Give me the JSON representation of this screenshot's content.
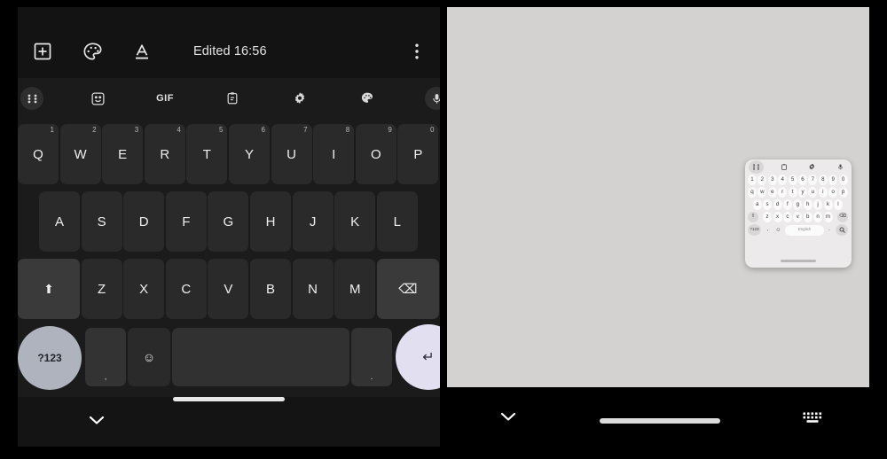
{
  "left_panel": {
    "toolbar": {
      "add_icon": "add-box-icon",
      "palette_icon": "palette-icon",
      "format_icon": "format-text-underline-icon",
      "status_text": "Edited 16:56",
      "overflow_icon": "more-vertical-icon"
    },
    "keyboard_strip": {
      "items": [
        {
          "name": "grid-menu-icon",
          "label": ""
        },
        {
          "name": "sticker-icon",
          "label": ""
        },
        {
          "name": "gif-icon",
          "label": "GIF"
        },
        {
          "name": "clipboard-icon",
          "label": ""
        },
        {
          "name": "settings-gear-icon",
          "label": ""
        },
        {
          "name": "theme-palette-icon",
          "label": ""
        },
        {
          "name": "microphone-icon",
          "label": ""
        }
      ]
    },
    "keyboard": {
      "row1": [
        {
          "key": "Q",
          "sup": "1"
        },
        {
          "key": "W",
          "sup": "2"
        },
        {
          "key": "E",
          "sup": "3"
        },
        {
          "key": "R",
          "sup": "4"
        },
        {
          "key": "T",
          "sup": "5"
        },
        {
          "key": "Y",
          "sup": "6"
        },
        {
          "key": "U",
          "sup": "7"
        },
        {
          "key": "I",
          "sup": "8"
        },
        {
          "key": "O",
          "sup": "9"
        },
        {
          "key": "P",
          "sup": "0"
        }
      ],
      "row2": [
        "A",
        "S",
        "D",
        "F",
        "G",
        "H",
        "J",
        "K",
        "L"
      ],
      "row3": {
        "shift_label": "⬆",
        "letters": [
          "Z",
          "X",
          "C",
          "V",
          "B",
          "N",
          "M"
        ],
        "backspace_label": "⌫"
      },
      "row4": {
        "symbols_label": "?123",
        "comma_label": ",",
        "emoji_label": "☺",
        "space_label": "",
        "period_label": ".",
        "enter_label": "↵"
      }
    },
    "nav_bar": {
      "back_icon": "chevron-down-icon",
      "home_indicator": "home-pill"
    }
  },
  "right_panel": {
    "canvas_label": "",
    "mini_keyboard": {
      "strip": [
        {
          "name": "grid-menu-icon"
        },
        {
          "name": "clipboard-icon"
        },
        {
          "name": "settings-gear-icon"
        },
        {
          "name": "microphone-icon"
        }
      ],
      "row_numbers": [
        "1",
        "2",
        "3",
        "4",
        "5",
        "6",
        "7",
        "8",
        "9",
        "0"
      ],
      "row1": [
        "q",
        "w",
        "e",
        "r",
        "t",
        "y",
        "u",
        "i",
        "o",
        "p"
      ],
      "row2": [
        "a",
        "s",
        "d",
        "f",
        "g",
        "h",
        "j",
        "k",
        "l"
      ],
      "row3": {
        "shift_label": "⇧",
        "letters": [
          "z",
          "x",
          "c",
          "v",
          "b",
          "n",
          "m"
        ],
        "backspace_label": "⌫"
      },
      "row4": {
        "symbols_label": "?123",
        "comma_label": ",",
        "emoji_label": "☺",
        "space_label": "English",
        "period_label": ".",
        "search_label": "search-icon"
      }
    },
    "nav_bar": {
      "back_icon": "chevron-down-icon",
      "home_indicator": "home-pill",
      "keyboard_icon": "keyboard-icon"
    }
  },
  "colors": {
    "left_bg": "#121212",
    "keyboard_bg": "#1b1b1b",
    "key_bg": "#2a2a2a",
    "key_light_bg": "#3a3a3a",
    "symbols_key": "#aeb3bd",
    "enter_key": "#e2e0f0",
    "right_canvas": "#d3d2d0",
    "mini_kb_bg": "#eceaea"
  }
}
